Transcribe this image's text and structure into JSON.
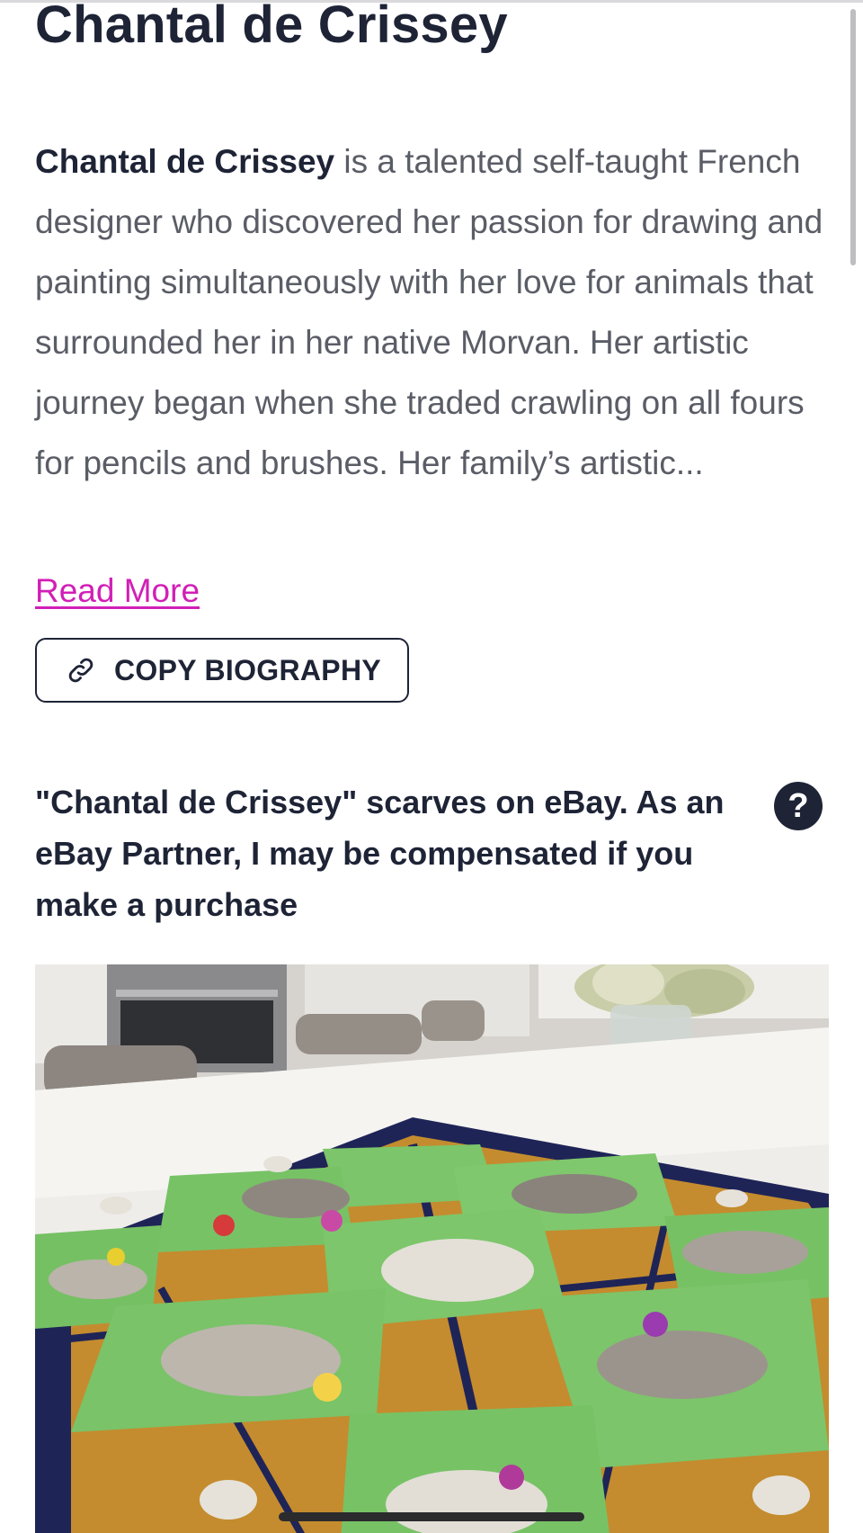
{
  "artist": {
    "name": "Chantal de Crissey"
  },
  "biography": {
    "lead_name": "Chantal de Crissey",
    "text": " is a talented self-taught French designer who discovered her passion for drawing and painting simultaneously with her love for animals that surrounded her in her native Morvan. Her artistic journey began when she traded crawling on all fours for pencils and brushes. Her family’s artistic...",
    "read_more_label": "Read More"
  },
  "actions": {
    "copy_biography_label": "COPY BIOGRAPHY",
    "copy_icon": "link-icon"
  },
  "ebay": {
    "heading": "\"Chantal de Crissey\" scarves on eBay. As an eBay Partner, I may be compensated if you make a purchase",
    "help_icon_glyph": "?",
    "help_icon": "question-circle-icon"
  },
  "colors": {
    "text_dark": "#1e2436",
    "text_body": "#5a5d66",
    "link_accent": "#d11fb6"
  }
}
